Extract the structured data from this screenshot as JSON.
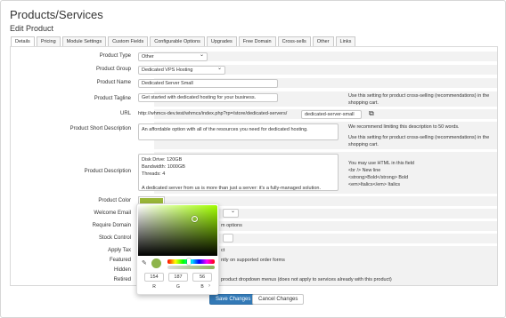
{
  "header": {
    "title": "Products/Services",
    "subtitle": "Edit Product"
  },
  "tabs": [
    {
      "label": "Details",
      "active": true
    },
    {
      "label": "Pricing"
    },
    {
      "label": "Module Settings"
    },
    {
      "label": "Custom Fields"
    },
    {
      "label": "Configurable Options"
    },
    {
      "label": "Upgrades"
    },
    {
      "label": "Free Domain"
    },
    {
      "label": "Cross-sells"
    },
    {
      "label": "Other"
    },
    {
      "label": "Links"
    }
  ],
  "form": {
    "product_type": {
      "label": "Product Type",
      "value": "Other"
    },
    "product_group": {
      "label": "Product Group",
      "value": "Dedicated VPS Hosting"
    },
    "product_name": {
      "label": "Product Name",
      "value": "Dedicated Server Small"
    },
    "product_tagline": {
      "label": "Product Tagline",
      "value": "Get started with dedicated hosting for your business.",
      "note": "Use this setting for product cross-selling (recommendations) in the shopping cart."
    },
    "url": {
      "label": "URL",
      "prefix": "http://whmcs-dev.test/whmcs/index.php?rp=/store/dedicated-servers/",
      "slug": "dedicated-server-small"
    },
    "short_description": {
      "label": "Product Short Description",
      "value": "An affordable option with all of the resources you need for dedicated hosting.",
      "note1": "We recommend limiting this description to 50 words.",
      "note2": "Use this setting for product cross-selling (recommendations) in the shopping cart."
    },
    "description": {
      "label": "Product Description",
      "value": "Disk Drive: 120GB\nBandwidth: 1000GB\nThreads: 4\n\nA dedicated server from us is more than just a server: it's a fully-managed solution.",
      "note_lines": [
        "You may use HTML in this field",
        "<br /> New line",
        "<strong>Bold</strong> Bold",
        "<em>Italics</em> Italics"
      ]
    },
    "product_color": {
      "label": "Product Color",
      "value": "#9ab738"
    },
    "welcome_email": {
      "label": "Welcome Email"
    },
    "require_domain": {
      "label": "Require Domain",
      "partial": "m options"
    },
    "stock_control": {
      "label": "Stock Control"
    },
    "apply_tax": {
      "label": "Apply Tax",
      "partial": "ct"
    },
    "featured": {
      "label": "Featured",
      "partial": "ntly on supported order forms"
    },
    "hidden": {
      "label": "Hidden"
    },
    "retired": {
      "label": "Retired",
      "partial": "product dropdown menus (does not apply to services already with this product)"
    }
  },
  "color_picker": {
    "rgb": {
      "r": "154",
      "g": "187",
      "b": "56"
    },
    "labels": {
      "r": "R",
      "g": "G",
      "b": "B"
    },
    "toggle": "›"
  },
  "buttons": {
    "save": "Save Changes",
    "cancel": "Cancel Changes"
  },
  "colors": {
    "primary": "#337ab7",
    "swatch": "#9ab738",
    "preview": "#8db44a"
  }
}
